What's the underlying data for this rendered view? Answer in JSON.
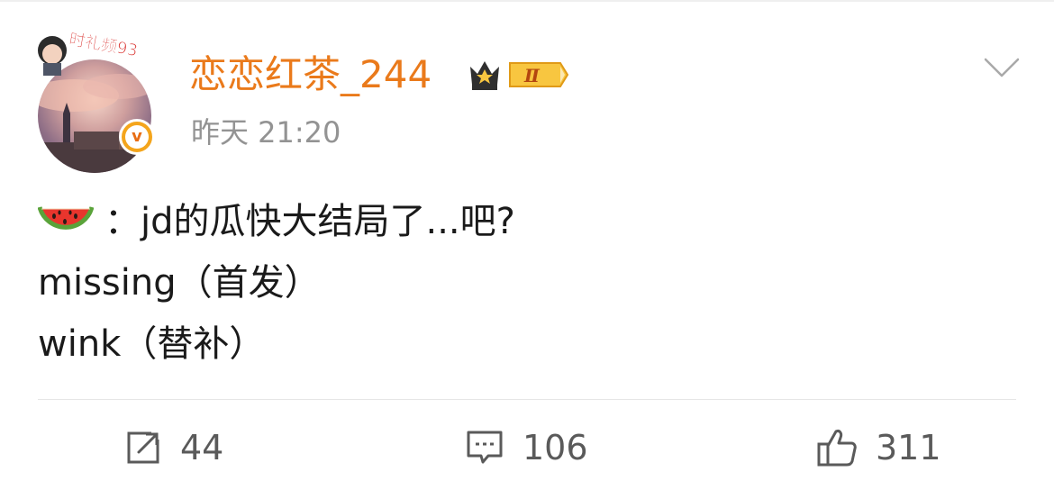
{
  "post": {
    "username": "恋恋红茶_244",
    "member_level": "Ⅱ",
    "verified_label": "v",
    "timestamp": "昨天 21:20",
    "avatar_pendant_text": "时礼频93",
    "body": {
      "line1_emoji": "watermelon",
      "line1_text": "：jd的瓜快大结局了...吧?",
      "line2_text": "missing（首发）",
      "line3_text": "wink（替补）"
    },
    "actions": {
      "repost_count": "44",
      "comment_count": "106",
      "like_count": "311"
    },
    "colors": {
      "username": "#ea7a1b",
      "timestamp": "#939393",
      "body_text": "#1a1a1a",
      "action_text": "#5a5a5a",
      "verified_badge": "#f4a51c",
      "member_badge": "#f5b800"
    }
  }
}
